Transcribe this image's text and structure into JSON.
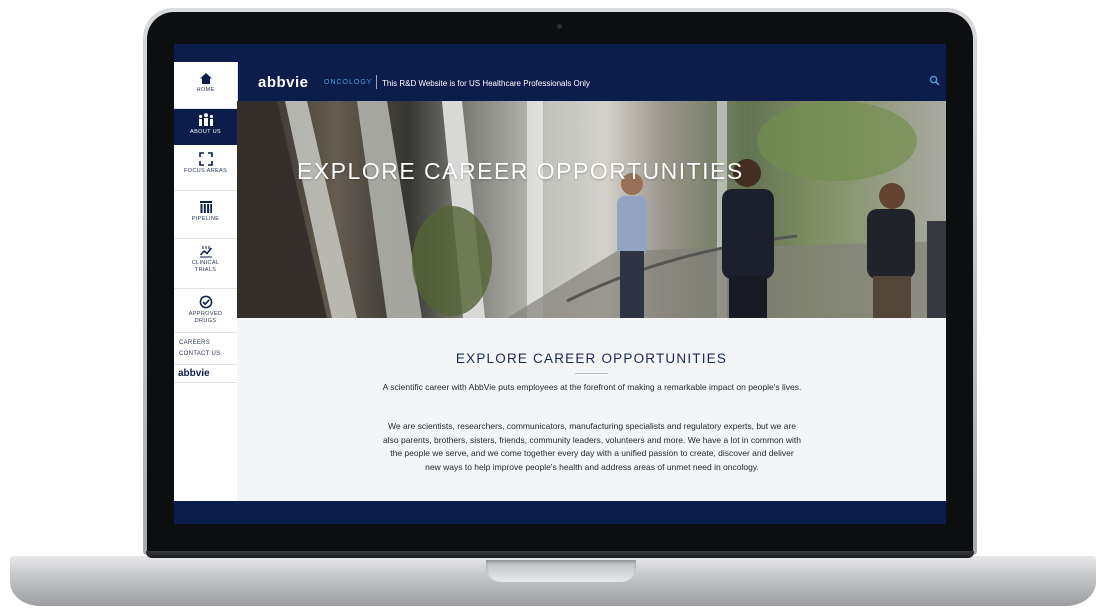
{
  "brand": {
    "logo": "abbvie",
    "sub": "ONCOLOGY",
    "notice": "This R&D Website is for US Healthcare Professionals Only"
  },
  "sidebar": {
    "items": [
      {
        "label": "HOME",
        "icon": "home-icon"
      },
      {
        "label": "ABOUT US",
        "icon": "people-icon",
        "active": true
      },
      {
        "label": "FOCUS AREAS",
        "icon": "focus-icon"
      },
      {
        "label": "PIPELINE",
        "icon": "pipeline-icon"
      },
      {
        "label": "CLINICAL",
        "label2": "TRIALS",
        "icon": "trials-icon"
      },
      {
        "label": "APPROVED",
        "label2": "DRUGS",
        "icon": "check-icon"
      }
    ],
    "links": [
      "CAREERS",
      "CONTACT US"
    ],
    "logo": "abbvie"
  },
  "hero": {
    "title": "EXPLORE CAREER OPPORTUNITIES"
  },
  "content": {
    "title": "EXPLORE CAREER OPPORTUNITIES",
    "p1": "A scientific career with AbbVie puts employees at the forefront of making a remarkable impact on people's lives.",
    "p2": "We are scientists, researchers, communicators, manufacturing specialists and regulatory experts, but we are also parents, brothers, sisters, friends, community leaders, volunteers and more. We have a lot in common with the people we serve, and we come together every day with a unified passion to create, discover and deliver new ways to help improve people's health and address areas of unmet need in oncology."
  },
  "colors": {
    "navy": "#0c1c4b",
    "accent": "#4f9bd9"
  }
}
